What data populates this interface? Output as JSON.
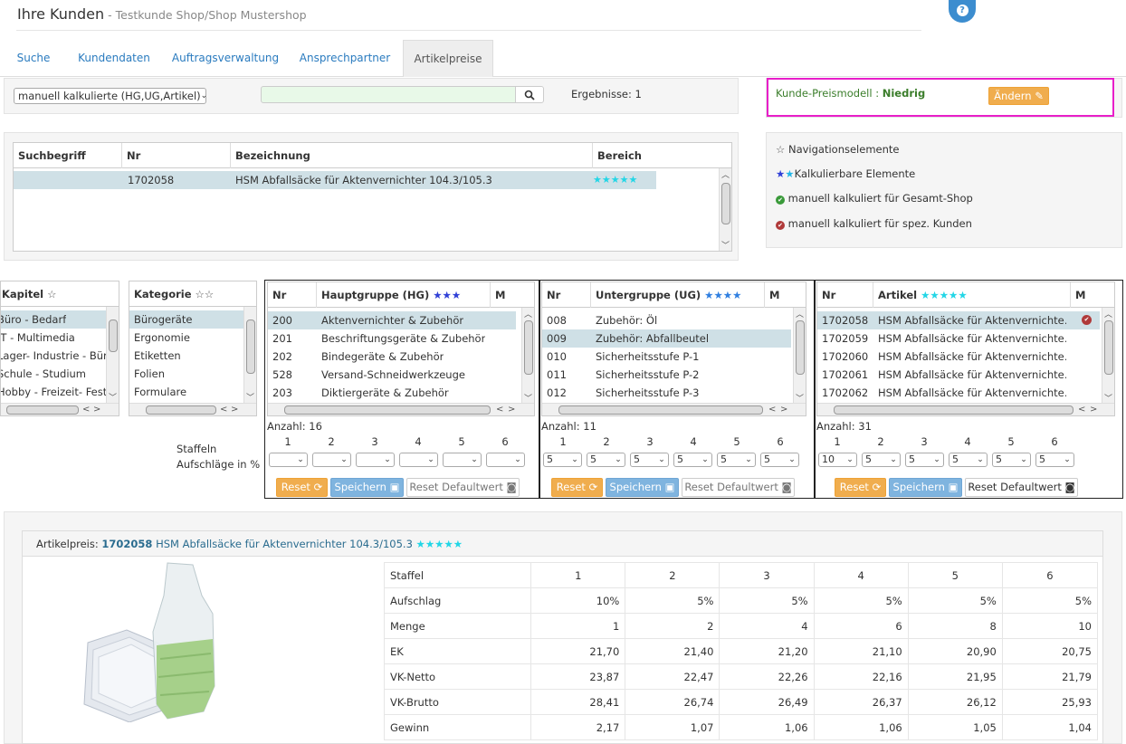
{
  "header": {
    "title": "Ihre Kunden",
    "subtitle": "- Testkunde Shop/Shop Mustershop",
    "help_icon": "?"
  },
  "tabs": [
    {
      "label": "Suche"
    },
    {
      "label": "Kundendaten"
    },
    {
      "label": "Auftragsverwaltung"
    },
    {
      "label": "Ansprechpartner"
    },
    {
      "label": "Artikelpreise",
      "active": true
    }
  ],
  "filter": {
    "select_value": "manuell kalkulierte (HG,UG,Artikel)",
    "search_value": "",
    "results_label": "Ergebnisse: 1"
  },
  "price_model": {
    "label": "Kunde-Preismodell :",
    "value": "Niedrig",
    "change_button": "Ändern"
  },
  "results_grid": {
    "columns": [
      "Suchbegriff",
      "Nr",
      "Bezeichnung",
      "Bereich"
    ],
    "rows": [
      {
        "suchbegriff": "",
        "nr": "1702058",
        "bezeichnung": "HSM Abfallsäcke für Aktenvernichter 104.3/105.3",
        "bereich": "★★★★★"
      }
    ]
  },
  "legend": {
    "items": [
      {
        "icon": "☆",
        "label": "Navigationselemente"
      },
      {
        "icon": "★★",
        "label": "Kalkulierbare Elemente"
      },
      {
        "icon": "✔",
        "label": "manuell kalkuliert für Gesamt-Shop"
      },
      {
        "icon": "✔",
        "label": "manuell kalkuliert für spez. Kunden"
      }
    ]
  },
  "kapitel": {
    "header": "Kapitel",
    "header_stars": "☆",
    "items": [
      "Büro - Bedarf",
      "IT - Multimedia",
      "Lager- Industrie - Bür.",
      "Schule - Studium",
      "Hobby - Freizeit- Feste"
    ]
  },
  "kategorie": {
    "header": "Kategorie",
    "header_stars": "☆☆",
    "items": [
      "Bürogeräte",
      "Ergonomie",
      "Etiketten",
      "Folien",
      "Formulare"
    ]
  },
  "hauptgruppe": {
    "col_nr": "Nr",
    "header": "Hauptgruppe (HG)",
    "header_stars": "★★★",
    "col_m": "M",
    "rows": [
      {
        "nr": "200",
        "name": "Aktenvernichter & Zubehör"
      },
      {
        "nr": "201",
        "name": "Beschriftungsgeräte & Zubehör"
      },
      {
        "nr": "202",
        "name": "Bindegeräte & Zubehör"
      },
      {
        "nr": "528",
        "name": "Versand-Schneidwerkzeuge"
      },
      {
        "nr": "203",
        "name": "Diktiergeräte & Zubehör"
      }
    ],
    "count": "Anzahl: 16",
    "staffel_values": [
      "",
      "",
      "",
      "",
      "",
      ""
    ]
  },
  "untergruppe": {
    "col_nr": "Nr",
    "header": "Untergruppe (UG)",
    "header_stars": "★★★★",
    "col_m": "M",
    "rows": [
      {
        "nr": "008",
        "name": "Zubehör: Öl"
      },
      {
        "nr": "009",
        "name": "Zubehör: Abfallbeutel"
      },
      {
        "nr": "010",
        "name": "Sicherheitsstufe P-1"
      },
      {
        "nr": "011",
        "name": "Sicherheitsstufe P-2"
      },
      {
        "nr": "012",
        "name": "Sicherheitsstufe P-3"
      }
    ],
    "count": "Anzahl: 11",
    "staffel_values": [
      "5",
      "5",
      "5",
      "5",
      "5",
      "5"
    ]
  },
  "artikel": {
    "col_nr": "Nr",
    "header": "Artikel",
    "header_stars": "★★★★★",
    "col_m": "M",
    "rows": [
      {
        "nr": "1702058",
        "name": "HSM Abfallsäcke für Aktenvernichte…"
      },
      {
        "nr": "1702059",
        "name": "HSM Abfallsäcke für Aktenvernichte…"
      },
      {
        "nr": "1702060",
        "name": "HSM Abfallsäcke für Aktenvernichte…"
      },
      {
        "nr": "1702061",
        "name": "HSM Abfallsäcke für Aktenvernichte…"
      },
      {
        "nr": "1702062",
        "name": "HSM Abfallsäcke für Aktenvernichte…"
      }
    ],
    "count": "Anzahl: 31",
    "staffel_values": [
      "10",
      "5",
      "5",
      "5",
      "5",
      "5"
    ]
  },
  "staffel": {
    "label_line1": "Staffeln",
    "label_line2": "Aufschläge in %",
    "numbers": [
      "1",
      "2",
      "3",
      "4",
      "5",
      "6"
    ]
  },
  "buttons": {
    "reset": "Reset",
    "save": "Speichern",
    "reset_default": "Reset Defaultwert"
  },
  "article_price": {
    "label": "Artikelpreis:",
    "nr": "1702058",
    "name": "HSM Abfallsäcke für Aktenvernichter 104.3/105.3",
    "stars": "★★★★★",
    "table": {
      "header": [
        "Staffel",
        "1",
        "2",
        "3",
        "4",
        "5",
        "6"
      ],
      "rows": [
        [
          "Aufschlag",
          "10%",
          "5%",
          "5%",
          "5%",
          "5%",
          "5%"
        ],
        [
          "Menge",
          "1",
          "2",
          "4",
          "6",
          "8",
          "10"
        ],
        [
          "EK",
          "21,70",
          "21,40",
          "21,20",
          "21,10",
          "20,90",
          "20,75"
        ],
        [
          "VK-Netto",
          "23,87",
          "22,47",
          "22,26",
          "22,16",
          "21,95",
          "21,79"
        ],
        [
          "VK-Brutto",
          "28,41",
          "26,74",
          "26,49",
          "26,37",
          "26,12",
          "25,93"
        ],
        [
          "Gewinn",
          "2,17",
          "1,07",
          "1,06",
          "1,06",
          "1,05",
          "1,04"
        ]
      ]
    }
  },
  "colors": {
    "accent_blue": "#2a7bbf",
    "highlight_pink": "#e81ec9",
    "warning_orange": "#f0ad4e",
    "selected_row": "#cfe0e6"
  }
}
